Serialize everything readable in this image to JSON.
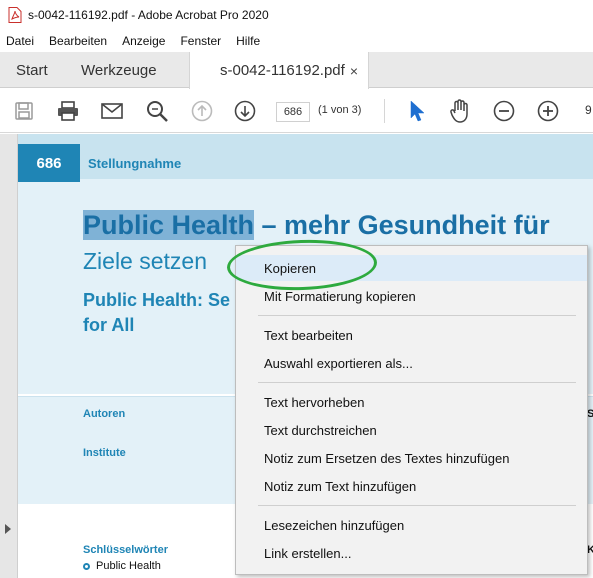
{
  "window": {
    "title": "s-0042-116192.pdf - Adobe Acrobat Pro 2020"
  },
  "menubar": [
    "Datei",
    "Bearbeiten",
    "Anzeige",
    "Fenster",
    "Hilfe"
  ],
  "tabs": {
    "start": "Start",
    "tools": "Werkzeuge",
    "document": "s-0042-116192.pdf",
    "close": "×"
  },
  "toolbar": {
    "page_number": "686",
    "page_count": "(1 von 3)",
    "zoom_partial": "9",
    "icons": [
      "save-icon",
      "print-icon",
      "mail-icon",
      "search-icon",
      "page-up-icon",
      "page-down-icon",
      "select-cursor-icon",
      "hand-icon",
      "zoom-out-icon",
      "zoom-in-icon"
    ]
  },
  "document": {
    "page_badge": "686",
    "section": "Stellungnahme",
    "title_highlight": "Public Health",
    "title_rest": " – mehr Gesundheit für",
    "subtitle": "Ziele setzen",
    "title_en_line1": "Public Health: Se",
    "title_en_line2": "for All",
    "authors_label": "Autoren",
    "institute_label": "Institute",
    "keywords_label": "Schlüsselwörter",
    "keyword_1": "Public Health"
  },
  "context_menu": {
    "items": [
      "Kopieren",
      "Mit Formatierung kopieren",
      "Text bearbeiten",
      "Auswahl exportieren als...",
      "Text hervorheben",
      "Text durchstreichen",
      "Notiz zum Ersetzen des Textes hinzufügen",
      "Notiz zum Text hinzufügen",
      "Lesezeichen hinzufügen",
      "Link erstellen..."
    ]
  },
  "colors": {
    "accent": "#1f85b5",
    "highlight": "#7fb2d6",
    "annotation": "#2eaa3e"
  }
}
